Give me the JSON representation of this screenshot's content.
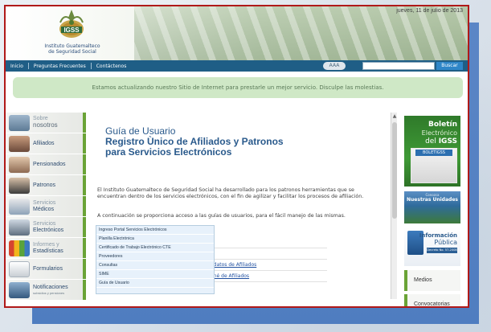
{
  "header": {
    "org_name_line1": "Instituto Guatemalteco",
    "org_name_line2": "de Seguridad Social",
    "logo_text": "IGSS",
    "date": "jueves, 11 de julio de 2013"
  },
  "nav": {
    "items": [
      "Inicio",
      "Preguntas Frecuentes",
      "Contáctenos"
    ],
    "font_size_label": "AAA",
    "search_placeholder": "",
    "search_button": "Buscar"
  },
  "notice": "Estamos actualizando nuestro Sitio de Internet para prestarle un mejor servicio. Disculpe las molestias.",
  "sidebar": {
    "items": [
      {
        "line1": "Sobre",
        "line2": "nosotros",
        "style": "light"
      },
      {
        "line1": "Afiliados",
        "line2": "",
        "style": "normal"
      },
      {
        "line1": "Pensionados",
        "line2": "",
        "style": "normal"
      },
      {
        "line1": "Patronos",
        "line2": "",
        "style": "normal"
      },
      {
        "line1": "Servicios",
        "line2": "Médicos",
        "style": "normal"
      },
      {
        "line1": "Servicios",
        "line2": "Electrónicos",
        "style": "normal"
      },
      {
        "line1": "Informes y",
        "line2": "Estadísticas",
        "style": "normal"
      },
      {
        "line1": "Formularios",
        "line2": "",
        "style": "normal"
      },
      {
        "line1": "Notificaciones",
        "line2": "subsidios y pensiones",
        "style": "normal"
      }
    ],
    "accent_color": "#6aa336"
  },
  "main": {
    "title_line1": "Guía de Usuario",
    "title_line2": "Registro Ùnico de Afiliados y Patronos",
    "title_line3": "para Servicios Electrónicos",
    "paragraph1": "El Instituto Guatemalteco de Seguridad Social ha desarrollado para los patronos herramientas que se encuentran dentro de los servicios electrónicos, con el fin de agilizar y facilitar los procesos de afiliación.",
    "paragraph2": "A continuación se proporciona acceso a las guías de usuarios, para el fácil manejo de las mismas.",
    "links": [
      "",
      "",
      "ón de datos de Afiliados",
      "de carné de Afiliados"
    ]
  },
  "dropdown": {
    "items": [
      "Ingreso Portal Servicios Electrónicos",
      "Planilla Electrónica",
      "Certificado de Trabajo Electrónico CTE",
      "Proveedores",
      "Consultas",
      "SIME",
      "Guía de Usuario"
    ]
  },
  "right_col": {
    "boletin_line1": "Boletín",
    "boletin_line2": "Electrónico",
    "boletin_line3_pre": "del",
    "boletin_line3_bold": "IGSS",
    "boletin_cover_tag": "BOLETIGSS",
    "unidades_small": "Conozca",
    "unidades_title": "Nuestras Unidades",
    "info_title": "Información",
    "info_sub": "Pública",
    "info_tag": "Decreto No. 57-2008",
    "buttons": [
      "Medios",
      "Convocatorias"
    ]
  },
  "colors": {
    "frame_border": "#b01919",
    "nav_bg": "#1f5e86",
    "title": "#2a5a8c",
    "notice_bg": "#cfe8c6"
  }
}
